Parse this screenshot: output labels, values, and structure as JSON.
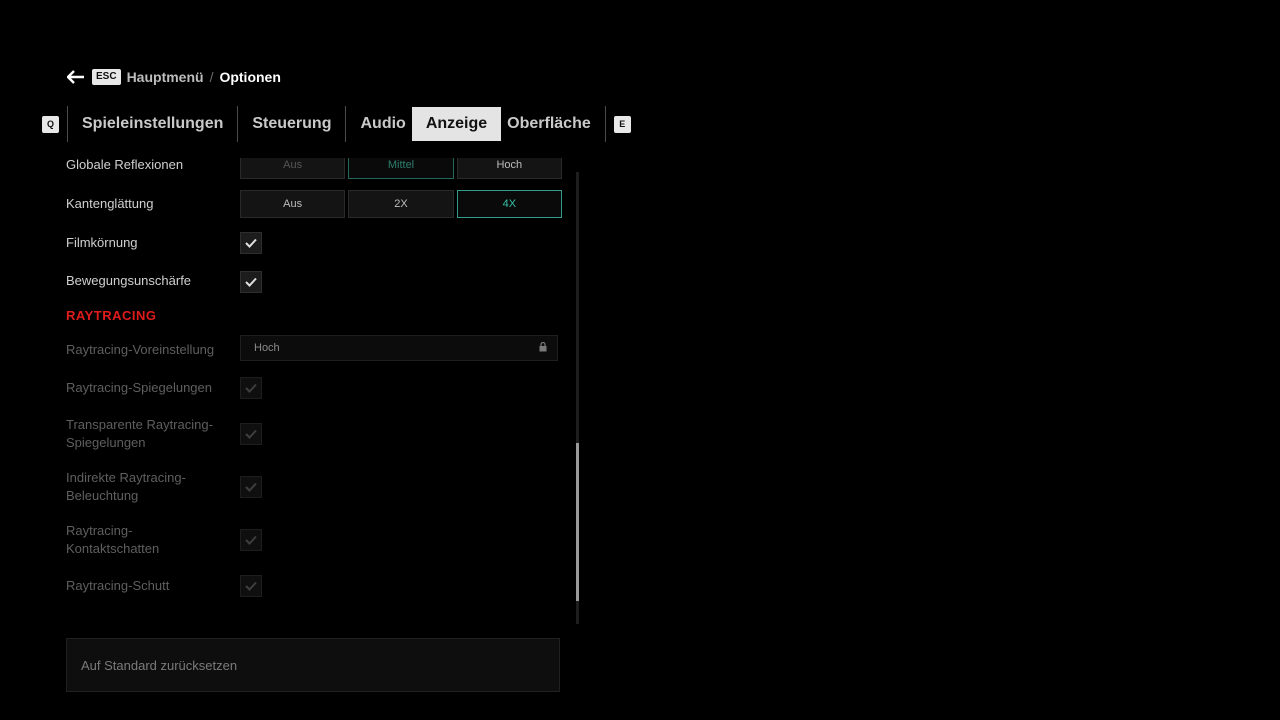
{
  "breadcrumb": {
    "back_key": "ESC",
    "parent": "Hauptmenü",
    "separator": "/",
    "current": "Optionen"
  },
  "tabs": {
    "left_key": "Q",
    "right_key": "E",
    "items": [
      {
        "label": "Spieleinstellungen",
        "active": false
      },
      {
        "label": "Steuerung",
        "active": false
      },
      {
        "label": "Audio",
        "active": false
      },
      {
        "label": "Anzeige",
        "active": true
      },
      {
        "label": "Oberfläche",
        "active": false
      }
    ]
  },
  "settings": {
    "global_reflections": {
      "label": "Globale Reflexionen",
      "options": [
        "Aus",
        "Mittel",
        "Hoch"
      ],
      "selected": "Mittel"
    },
    "antialiasing": {
      "label": "Kantenglättung",
      "options": [
        "Aus",
        "2X",
        "4X"
      ],
      "selected": "4X"
    },
    "film_grain": {
      "label": "Filmkörnung",
      "checked": true
    },
    "motion_blur": {
      "label": "Bewegungsunschärfe",
      "checked": true
    }
  },
  "raytracing": {
    "title": "RAYTRACING",
    "preset": {
      "label": "Raytracing-Voreinstellung",
      "value": "Hoch",
      "locked": true
    },
    "reflections": {
      "label": "Raytracing-Spiegelungen",
      "checked": true
    },
    "transparent_reflections": {
      "label": "Transparente Raytracing-Spiegelungen",
      "line1": "Transparente Raytracing-",
      "line2": "Spiegelungen",
      "checked": true
    },
    "indirect_lighting": {
      "label": "Indirekte Raytracing-Beleuchtung",
      "line1": "Indirekte Raytracing-",
      "line2": "Beleuchtung",
      "checked": true
    },
    "contact_shadows": {
      "label": "Raytracing-Kontaktschatten",
      "line1": "Raytracing-",
      "line2": "Kontaktschatten",
      "checked": true
    },
    "debris": {
      "label": "Raytracing-Schutt",
      "checked": true
    }
  },
  "reset_button": "Auf Standard zurücksetzen",
  "colors": {
    "accent_teal": "#36c2a5",
    "section_red": "#e01b1b",
    "background": "#000000"
  }
}
